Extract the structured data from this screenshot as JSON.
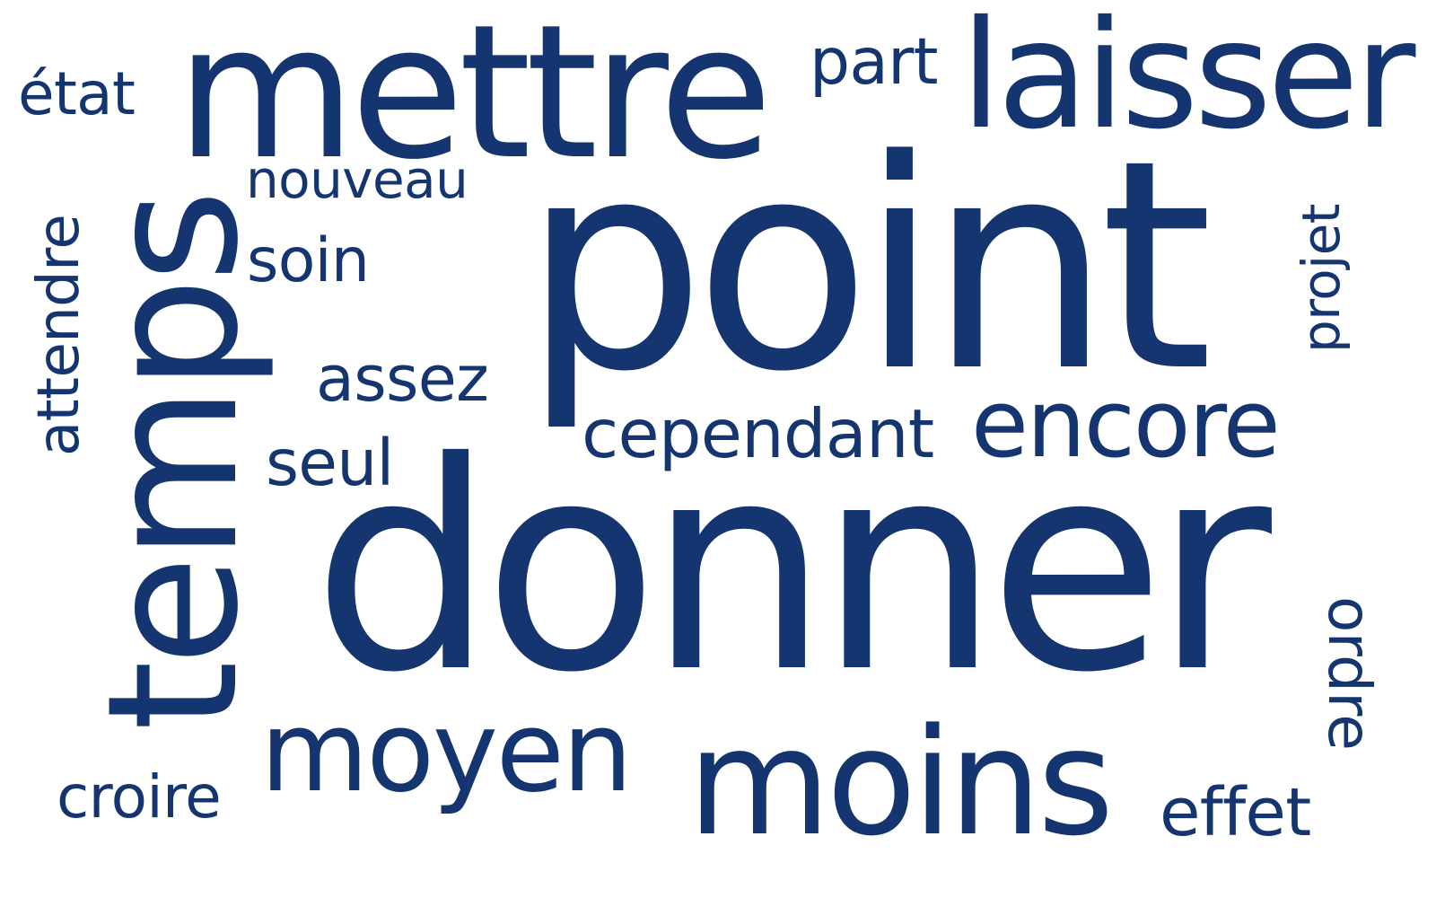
{
  "colors": {
    "word": "#14356f",
    "background": "#ffffff"
  },
  "words": {
    "etat": "état",
    "mettre": "mettre",
    "part": "part",
    "laisser": "laisser",
    "nouveau": "nouveau",
    "attendre": "attendre",
    "temps": "temps",
    "soin": "soin",
    "point": "point",
    "projet": "projet",
    "assez": "assez",
    "cependant": "cependant",
    "encore": "encore",
    "seul": "seul",
    "donner": "donner",
    "ordre": "ordre",
    "moyen": "moyen",
    "moins": "moins",
    "croire": "croire",
    "effet": "effet"
  }
}
